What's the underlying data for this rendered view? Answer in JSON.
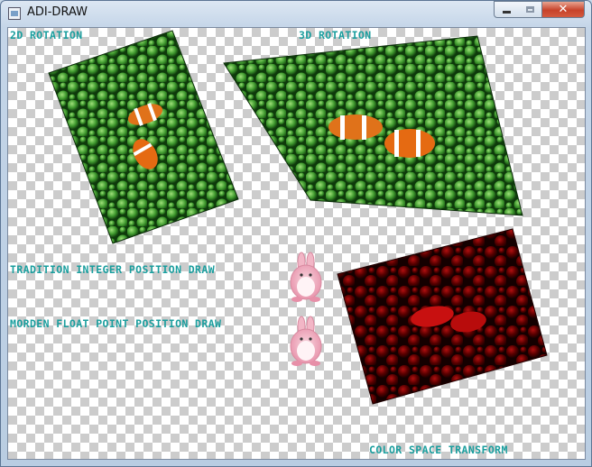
{
  "window": {
    "title": "ADI-DRAW",
    "controls": {
      "minimize_icon": "minimize-icon",
      "maximize_icon": "maximize-icon",
      "close_glyph": "✕"
    }
  },
  "labels": {
    "rotation_2d": "2D ROTATION",
    "rotation_3d": "3D ROTATION",
    "integer_draw": "TRADITION INTEGER POSITION DRAW",
    "float_draw": "MORDEN FLOAT POINT POSITION DRAW",
    "color_transform": "COLOR SPACE TRANSFORM"
  },
  "colors": {
    "label_text": "#1a9e9e",
    "anemone_green": "#2f8a2a",
    "anemone_red": "#7a0000",
    "clownfish_orange": "#e0721a",
    "bunny_pink": "#f2b6c6"
  }
}
